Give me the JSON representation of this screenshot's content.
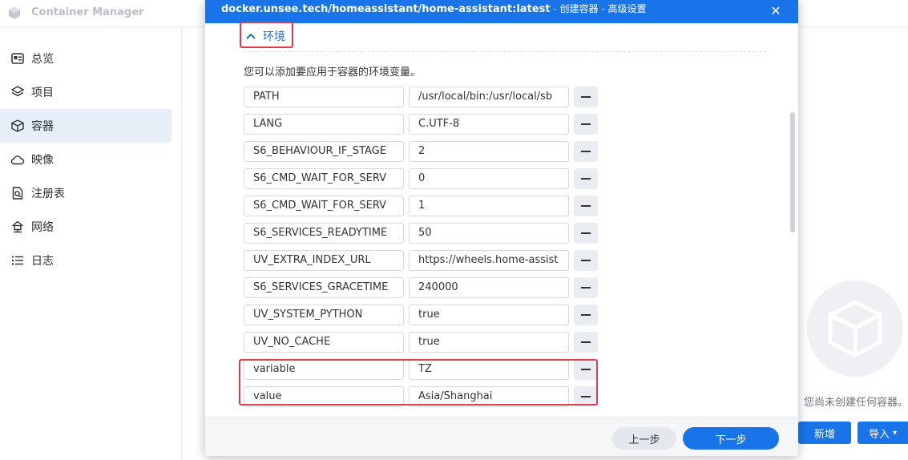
{
  "app": {
    "title": "Container Manager",
    "sidebar": [
      {
        "label": "总览",
        "icon": "overview-icon"
      },
      {
        "label": "项目",
        "icon": "project-icon"
      },
      {
        "label": "容器",
        "icon": "container-icon",
        "active": true
      },
      {
        "label": "映像",
        "icon": "image-cloud-icon"
      },
      {
        "label": "注册表",
        "icon": "registry-icon"
      },
      {
        "label": "网络",
        "icon": "network-icon"
      },
      {
        "label": "日志",
        "icon": "log-icon"
      }
    ],
    "empty_text": "您尚未创建任何容器。",
    "new_button": "新增",
    "import_button": "导入",
    "import_caret": "▾"
  },
  "modal": {
    "title": "docker.unsee.tech/homeassistant/home-assistant:latest",
    "subtitle": " - 创建容器 - 高级设置",
    "close_glyph": "✕",
    "section": {
      "label": "环境",
      "expanded": true
    },
    "description": "您可以添加要应用于容器的环境变量。",
    "env_vars": [
      {
        "key": "PATH",
        "value": "/usr/local/bin:/usr/local/sb"
      },
      {
        "key": "LANG",
        "value": "C.UTF-8"
      },
      {
        "key": "S6_BEHAVIOUR_IF_STAGE",
        "value": "2"
      },
      {
        "key": "S6_CMD_WAIT_FOR_SERV",
        "value": "0"
      },
      {
        "key": "S6_CMD_WAIT_FOR_SERV",
        "value": "1"
      },
      {
        "key": "S6_SERVICES_READYTIME",
        "value": "50"
      },
      {
        "key": "UV_EXTRA_INDEX_URL",
        "value": "https://wheels.home-assist"
      },
      {
        "key": "S6_SERVICES_GRACETIME",
        "value": "240000"
      },
      {
        "key": "UV_SYSTEM_PYTHON",
        "value": "true"
      },
      {
        "key": "UV_NO_CACHE",
        "value": "true"
      },
      {
        "key": "variable",
        "value": "TZ"
      },
      {
        "key": "value",
        "value": "Asia/Shanghai"
      }
    ],
    "footer": {
      "prev": "上一步",
      "next": "下一步"
    }
  },
  "colors": {
    "primary": "#1874e8",
    "highlight": "#e03c4e",
    "active_bg": "#e7eef8"
  }
}
